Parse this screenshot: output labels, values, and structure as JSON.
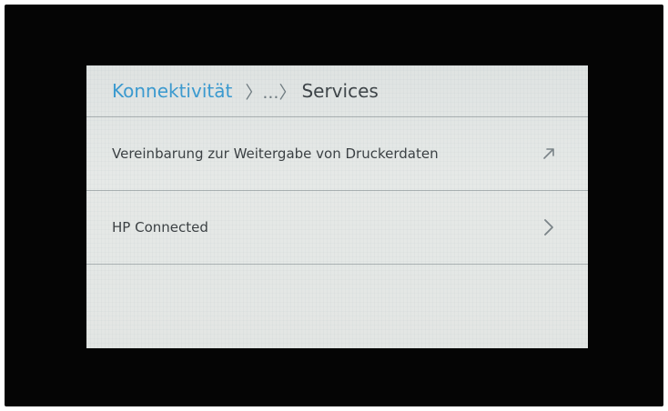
{
  "breadcrumb": {
    "parent_label": "Konnektivität",
    "ellipsis": "〉...〉",
    "current_label": "Services"
  },
  "items": [
    {
      "label": "Vereinbarung zur Weitergabe von Druckerdaten",
      "icon": "external-arrow-icon"
    },
    {
      "label": "HP Connected",
      "icon": "chevron-right-icon"
    }
  ],
  "colors": {
    "accent": "#3a9ad0",
    "text": "#3a3f42",
    "background": "#e3e6e4",
    "bezel": "#050505"
  }
}
